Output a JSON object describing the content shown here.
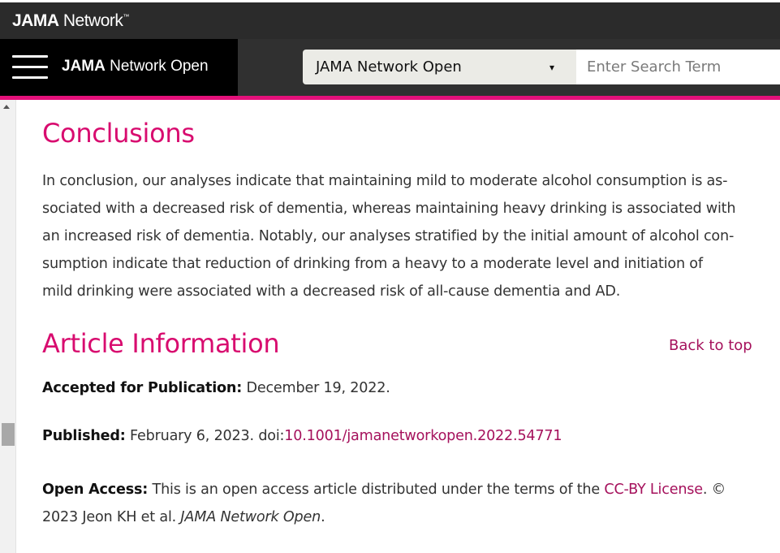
{
  "topbar": {
    "brand_bold": "JAMA",
    "brand_rest": " Network",
    "brand_tm": "™"
  },
  "navbar": {
    "journal_bold": "JAMA",
    "journal_rest": " Network Open",
    "select_value": "JAMA Network Open",
    "select_caret": "▾",
    "search_placeholder": "Enter Search Term"
  },
  "conclusions": {
    "heading": "Conclusions",
    "lines": [
      "In conclusion, our analyses indicate that maintaining mild to moderate alcohol consumption is as-",
      "sociated with a decreased risk of dementia, whereas maintaining heavy drinking is associated with",
      "an increased risk of dementia. Notably, our analyses stratified by the initial amount of alcohol con-",
      "sumption indicate that reduction of drinking from a heavy to a moderate level and initiation of",
      "mild drinking were associated with a decreased risk of all-cause dementia and AD."
    ]
  },
  "article_info": {
    "heading": "Article Information",
    "back_to_top": "Back to top",
    "accepted_label": "Accepted for Publication:",
    "accepted_value": " December 19, 2022.",
    "published_label": "Published:",
    "published_value": " February 6, 2023. doi:",
    "doi": "10.1001/jamanetworkopen.2022.54771",
    "open_access_label": "Open Access:",
    "open_access_text": " This is an open access article distributed under the terms of the ",
    "license_link": "CC-BY License",
    "open_access_end": ". ©",
    "copyright_line": "2023 Jeon KH et al. ",
    "journal_italic": "JAMA Network Open",
    "period": "."
  },
  "colors": {
    "accent": "#e4107a",
    "heading": "#d80c6f",
    "link": "#a5115c",
    "topbar": "#2b2b2b",
    "navbar": "#303030"
  },
  "icons": [
    "hamburger-menu-icon",
    "dropdown-caret-icon",
    "scroll-up-arrow-icon"
  ]
}
